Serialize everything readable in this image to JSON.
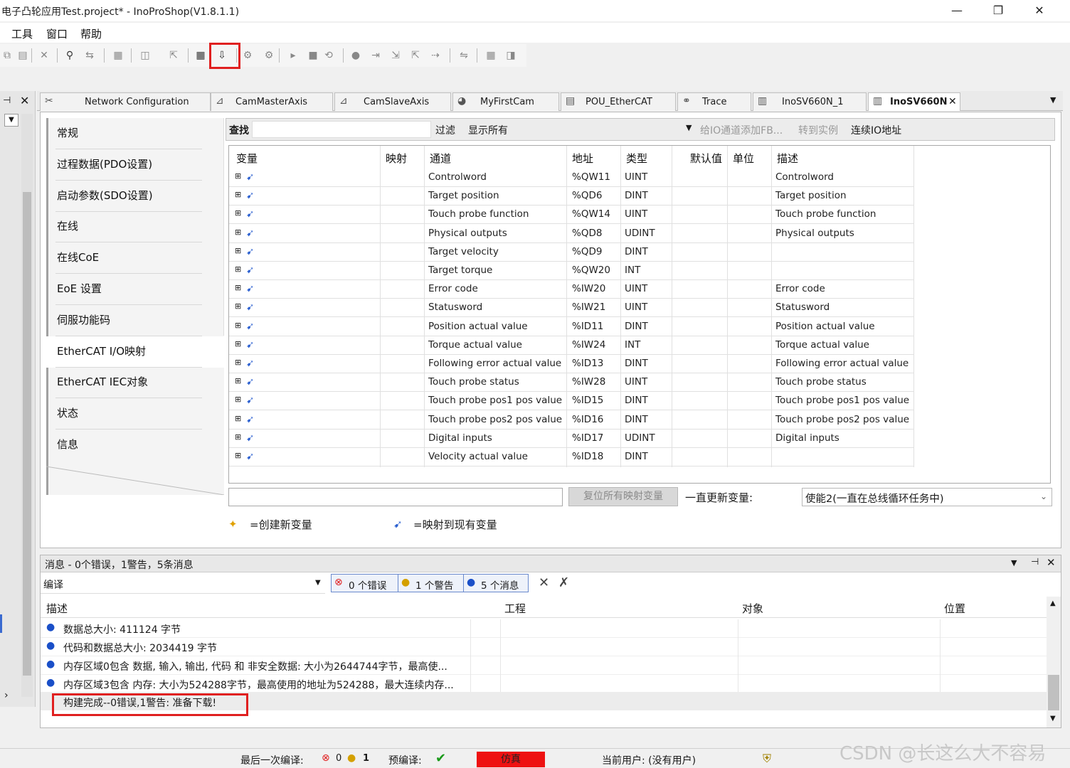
{
  "window": {
    "title": "电子凸轮应用Test.project* - InoProShop(V1.8.1.1)",
    "min": "—",
    "max": "❐",
    "close": "✕"
  },
  "menu": [
    "工具",
    "窗口",
    "帮助"
  ],
  "toolbar_icons": [
    "copy-icon",
    "paste-icon",
    "delete-icon",
    "find-icon",
    "replace-icon",
    "print-icon",
    "window-icon",
    "open-icon",
    "build-icon",
    "download-icon",
    "login-icon",
    "logout-icon",
    "run-icon",
    "stop-icon",
    "reset-icon",
    "breakpoint-icon",
    "step-over-icon",
    "step-into-icon",
    "step-out-icon",
    "run-to-cursor-icon",
    "flow-icon",
    "monitor-icon",
    "debug-icon"
  ],
  "tabs": [
    {
      "label": "Network Configuration",
      "icon": "network-icon"
    },
    {
      "label": "CamMasterAxis",
      "icon": "axis-icon"
    },
    {
      "label": "CamSlaveAxis",
      "icon": "axis-icon"
    },
    {
      "label": "MyFirstCam",
      "icon": "cam-icon"
    },
    {
      "label": "POU_EtherCAT",
      "icon": "pou-icon"
    },
    {
      "label": "Trace",
      "icon": "trace-icon"
    },
    {
      "label": "InoSV660N_1",
      "icon": "device-icon"
    },
    {
      "label": "InoSV660N",
      "icon": "device-icon",
      "close": "✕"
    }
  ],
  "nav": [
    "常规",
    "过程数据(PDO设置)",
    "启动参数(SDO设置)",
    "在线",
    "在线CoE",
    "EoE 设置",
    "伺服功能码",
    "EtherCAT I/O映射",
    "EtherCAT IEC对象",
    "状态",
    "信息"
  ],
  "filter": {
    "find_label": "查找",
    "filter_label": "过滤",
    "filter_value": "显示所有",
    "add_fb": "给IO通道添加FB...",
    "goto_instance": "转到实例",
    "continuous_io": "连续IO地址"
  },
  "columns": [
    "变量",
    "映射",
    "通道",
    "地址",
    "类型",
    "默认值",
    "单位",
    "描述"
  ],
  "rows": [
    {
      "channel": "Controlword",
      "address": "%QW11",
      "type": "UINT",
      "desc": "Controlword"
    },
    {
      "channel": "Target position",
      "address": "%QD6",
      "type": "DINT",
      "desc": "Target position"
    },
    {
      "channel": "Touch probe function",
      "address": "%QW14",
      "type": "UINT",
      "desc": "Touch probe function"
    },
    {
      "channel": "Physical outputs",
      "address": "%QD8",
      "type": "UDINT",
      "desc": "Physical outputs"
    },
    {
      "channel": "Target velocity",
      "address": "%QD9",
      "type": "DINT",
      "desc": ""
    },
    {
      "channel": "Target torque",
      "address": "%QW20",
      "type": "INT",
      "desc": ""
    },
    {
      "channel": "Error code",
      "address": "%IW20",
      "type": "UINT",
      "desc": "Error code"
    },
    {
      "channel": "Statusword",
      "address": "%IW21",
      "type": "UINT",
      "desc": "Statusword"
    },
    {
      "channel": "Position actual value",
      "address": "%ID11",
      "type": "DINT",
      "desc": "Position actual value"
    },
    {
      "channel": "Torque actual value",
      "address": "%IW24",
      "type": "INT",
      "desc": "Torque actual value"
    },
    {
      "channel": "Following error actual value",
      "address": "%ID13",
      "type": "DINT",
      "desc": "Following error actual value"
    },
    {
      "channel": "Touch probe status",
      "address": "%IW28",
      "type": "UINT",
      "desc": "Touch probe status"
    },
    {
      "channel": "Touch probe pos1 pos value",
      "address": "%ID15",
      "type": "DINT",
      "desc": "Touch probe pos1 pos value"
    },
    {
      "channel": "Touch probe pos2 pos value",
      "address": "%ID16",
      "type": "DINT",
      "desc": "Touch probe pos2 pos value"
    },
    {
      "channel": "Digital inputs",
      "address": "%ID17",
      "type": "UDINT",
      "desc": "Digital inputs"
    },
    {
      "channel": "Velocity actual value",
      "address": "%ID18",
      "type": "DINT",
      "desc": ""
    }
  ],
  "bottom": {
    "reset_mapping": "复位所有映射变量",
    "always_update": "一直更新变量:",
    "update_option": "使能2(一直在总线循环任务中)",
    "legend_new": "=创建新变量",
    "legend_map": "=映射到现有变量"
  },
  "messages": {
    "title": "消息 - 0个错误，1警告，5条消息",
    "category": "编译",
    "errors": "0 个错误",
    "warnings": "1 个警告",
    "infos": "5 个消息",
    "columns": [
      "描述",
      "工程",
      "对象",
      "位置"
    ],
    "rows": [
      "数据总大小: 411124 字节",
      "代码和数据总大小: 2034419 字节",
      "内存区域0包含 数据, 输入, 输出, 代码 和 非安全数据: 大小为2644744字节，最高使...",
      "内存区域3包含 内存: 大小为524288字节，最高使用的地址为524288，最大连续内存..."
    ],
    "build_done": "构建完成--0错误,1警告: 准备下载!"
  },
  "status": {
    "last_compile": "最后一次编译:",
    "err_count": "0",
    "warn_count": "1",
    "precompile": "预编译:",
    "simulate": "仿真",
    "current_user": "当前用户: (没有用户)"
  },
  "watermark": "CSDN @长这么大不容易",
  "colors": {
    "highlight": "#e02020",
    "simulate_bg": "#ee1111",
    "info": "#1a4fc8",
    "ok": "#1a9a1a"
  }
}
